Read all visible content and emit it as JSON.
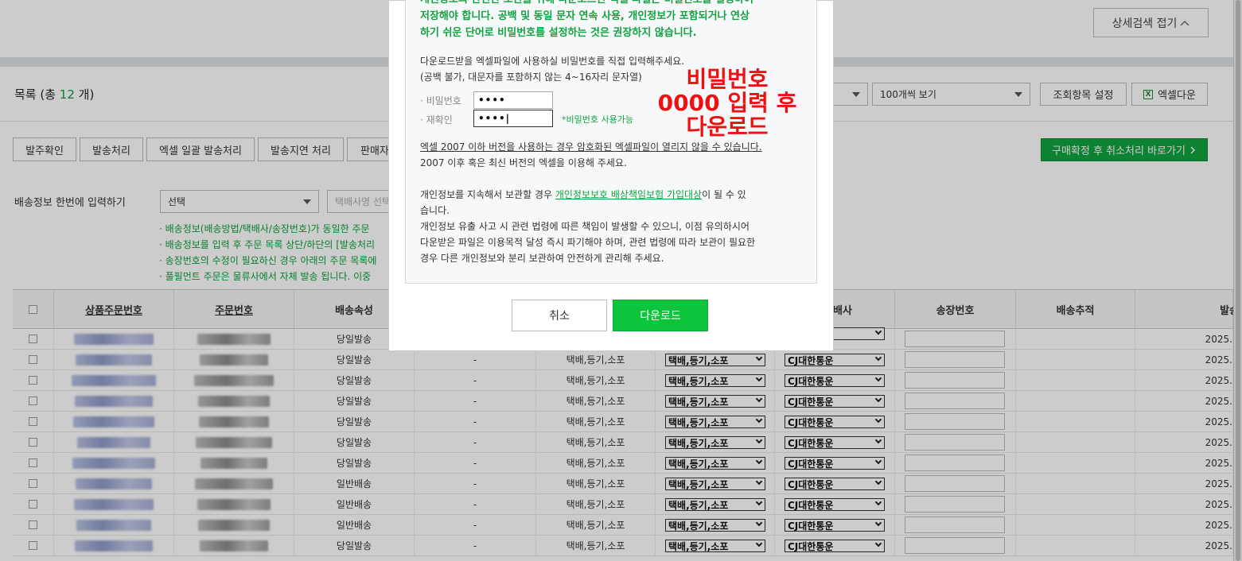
{
  "header": {
    "adv_search_label": "상세검색 접기"
  },
  "list": {
    "title_prefix": "목록 (총 ",
    "count": "12",
    "title_suffix": " 개)",
    "per_page_value": "100개씩 보기",
    "view_settings_label": "조회항목 설정",
    "excel_download_label": "엑셀다운",
    "xls_icon_glyph": "X"
  },
  "actions": {
    "buttons": [
      "발주확인",
      "발송처리",
      "엑셀 일괄 발송처리",
      "발송지연 처리",
      "판매자"
    ],
    "confirm_cancel_label": "구매확정 후 취소처리 바로가기"
  },
  "bulk": {
    "label": "배송정보 한번에 입력하기",
    "select_value": "선택",
    "courier_placeholder": "택배사명 선택",
    "notes": [
      "· 배송정보(배송방법/택배사/송장번호)가 동일한 주문",
      "· 배송정보를 입력 후 주문 목록 상단/하단의 [발송처리",
      "· 송장번호의 수정이 필요하신 경우 아래의 주문 목록에",
      "· 풀필먼트 주문은 물류사에서 자체 발송 됩니다. 이중"
    ]
  },
  "table": {
    "headers": {
      "product_order_no": "상품주문번호",
      "order_no": "주문번호",
      "delivery_attr": "배송속성",
      "courier": "배사",
      "invoice_no": "송장번호",
      "tracking": "배송추적",
      "ship_date": "발송"
    },
    "rows": [
      {
        "attr": "당일발송",
        "dash": "",
        "method": "",
        "sel_method": "",
        "sel_courier": "",
        "date": "2025."
      },
      {
        "attr": "당일발송",
        "dash": "-",
        "method": "택배,등기,소포",
        "sel_method": "택배,등기,소포",
        "sel_courier": "CJ대한통운",
        "date": "2025."
      },
      {
        "attr": "당일발송",
        "dash": "-",
        "method": "택배,등기,소포",
        "sel_method": "택배,등기,소포",
        "sel_courier": "CJ대한통운",
        "date": "2025."
      },
      {
        "attr": "당일발송",
        "dash": "-",
        "method": "택배,등기,소포",
        "sel_method": "택배,등기,소포",
        "sel_courier": "CJ대한통운",
        "date": "2025."
      },
      {
        "attr": "당일발송",
        "dash": "-",
        "method": "택배,등기,소포",
        "sel_method": "택배,등기,소포",
        "sel_courier": "CJ대한통운",
        "date": "2025."
      },
      {
        "attr": "당일발송",
        "dash": "-",
        "method": "택배,등기,소포",
        "sel_method": "택배,등기,소포",
        "sel_courier": "CJ대한통운",
        "date": "2025."
      },
      {
        "attr": "당일발송",
        "dash": "-",
        "method": "택배,등기,소포",
        "sel_method": "택배,등기,소포",
        "sel_courier": "CJ대한통운",
        "date": "2025."
      },
      {
        "attr": "일반배송",
        "dash": "-",
        "method": "택배,등기,소포",
        "sel_method": "택배,등기,소포",
        "sel_courier": "CJ대한통운",
        "date": "2025."
      },
      {
        "attr": "일반배송",
        "dash": "-",
        "method": "택배,등기,소포",
        "sel_method": "택배,등기,소포",
        "sel_courier": "CJ대한통운",
        "date": "2025."
      },
      {
        "attr": "일반배송",
        "dash": "-",
        "method": "택배,등기,소포",
        "sel_method": "택배,등기,소포",
        "sel_courier": "CJ대한통운",
        "date": "2025."
      },
      {
        "attr": "당일발송",
        "dash": "-",
        "method": "택배,등기,소포",
        "sel_method": "택배,등기,소포",
        "sel_courier": "CJ대한통운",
        "date": "2025."
      }
    ]
  },
  "modal": {
    "warning_lines": [
      "개인정보의 안전한 보관을 위해 다운로드된 엑셀 파일은 비밀번호를 설정하여",
      "저장해야 합니다. 공백 및 동일 문자 연속 사용, 개인정보가 포함되거나 연상",
      "하기 쉬운 단어로 비밀번호를 설정하는 것은 권장하지 않습니다."
    ],
    "instruction_1": "다운로드받을 엑셀파일에 사용하실 비밀번호를 직접 입력해주세요.",
    "instruction_2": "(공백 불가, 대문자를 포함하지 않는 4~16자리 문자열)",
    "password_label": "· 비밀번호",
    "password_value": "••••",
    "confirm_label": "· 재확인",
    "confirm_value": "••••|",
    "password_ok": "*비밀번호 사용가능",
    "overlay_line_1": "비밀번호",
    "overlay_line_2": "0000 입력 후",
    "overlay_line_3": "다운로드",
    "excel_note_1": "엑셀 2007 이하 버전을 사용하는 경우 암호화된 엑셀파일이 열리지 않을 수 있습니다.",
    "excel_note_2": "2007 이후 혹은 최신 버전의 엑셀을 이용해 주세요.",
    "privacy_prefix": "개인정보를 지속해서 보관할 경우 ",
    "privacy_link": "개인정보보호 배상책임보험 가입대상",
    "privacy_suffix": "이 될 수 있",
    "privacy_cont": "습니다.",
    "privacy_2": "개인정보 유출 사고 시 관련 법령에 따른 책임이 발생할 수 있으니, 이점 유의하시어",
    "privacy_3": "다운받은 파일은 이용목적 달성 즉시 파기해야 하며, 관련 법령에 따라 보관이 필요한",
    "privacy_4": "경우 다른 개인정보와 분리 보관하여 안전하게 관리해 주세요.",
    "cancel_label": "취소",
    "download_label": "다운로드"
  },
  "colors": {
    "accent": "#11a33f",
    "download_button": "#0fc43d",
    "overlay_text": "#ee1111"
  }
}
